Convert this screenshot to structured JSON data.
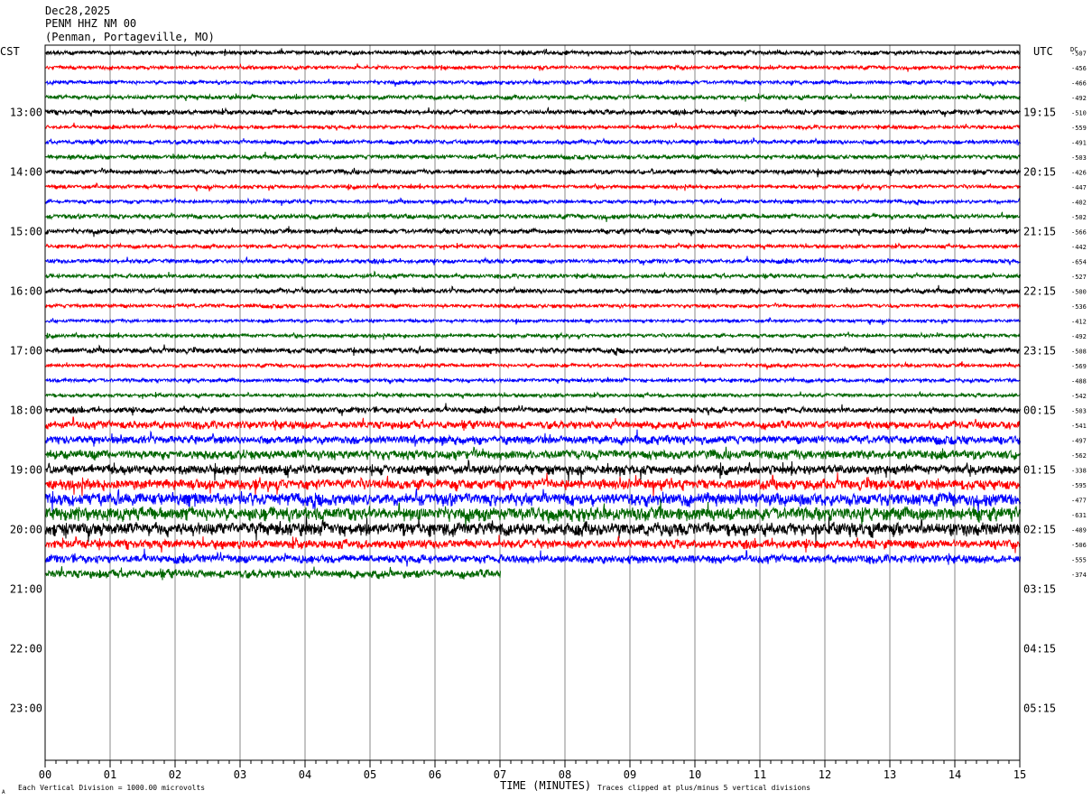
{
  "header": {
    "date": "Dec28,2025",
    "station": "PENM HHZ NM 00",
    "location": "(Penman, Portageville, MO)"
  },
  "labels": {
    "left_timezone": "CST",
    "right_timezone": "UTC",
    "dc_header": "DC",
    "x_axis_title": "TIME (MINUTES)",
    "scale_note": "Each Vertical Division = 1000.00 microvolts",
    "clip_note": "Traces clipped at plus/minus 5 vertical divisions",
    "corner_mark": "A"
  },
  "chart_data": {
    "type": "line",
    "title": "PENM HHZ NM 00",
    "xlabel": "TIME (MINUTES)",
    "xlim": [
      0,
      15
    ],
    "x_ticks": [
      "00",
      "01",
      "02",
      "03",
      "04",
      "05",
      "06",
      "07",
      "08",
      "09",
      "10",
      "11",
      "12",
      "13",
      "14",
      "15"
    ],
    "rows_total": 48,
    "rows_recorded": 36,
    "last_row_end_minute": 7,
    "row_colors": [
      "#000000",
      "#ff0000",
      "#0000ff",
      "#006600"
    ],
    "hour_labels_left": [
      "13:00",
      "14:00",
      "15:00",
      "16:00",
      "17:00",
      "18:00",
      "19:00",
      "20:00",
      "21:00",
      "22:00",
      "23:00"
    ],
    "hour_labels_right": [
      "19:15",
      "20:15",
      "21:15",
      "22:15",
      "23:15",
      "00:15",
      "01:15",
      "02:15",
      "03:15",
      "04:15",
      "05:15"
    ],
    "hour_label_first_row": 4,
    "dc_offsets": [
      "-507",
      "-456",
      "-466",
      "-492",
      "-510",
      "-559",
      "-491",
      "-503",
      "-426",
      "-447",
      "-402",
      "-502",
      "-566",
      "-442",
      "-654",
      "-527",
      "-500",
      "-536",
      "-412",
      "-492",
      "-508",
      "-569",
      "-488",
      "-542",
      "-503",
      "-541",
      "-497",
      "-562",
      "-338",
      "-595",
      "-477",
      "-631",
      "-489",
      "-506",
      "-555",
      "-374"
    ],
    "noise_level": [
      0.8,
      0.7,
      0.7,
      0.8,
      0.9,
      0.7,
      0.8,
      0.8,
      0.9,
      0.7,
      0.7,
      0.9,
      0.9,
      0.7,
      0.8,
      0.8,
      0.9,
      0.7,
      0.6,
      0.7,
      1.0,
      0.7,
      0.7,
      0.7,
      1.1,
      1.5,
      1.6,
      1.8,
      1.8,
      2.0,
      2.4,
      2.6,
      2.5,
      1.7,
      1.6,
      1.6
    ]
  }
}
